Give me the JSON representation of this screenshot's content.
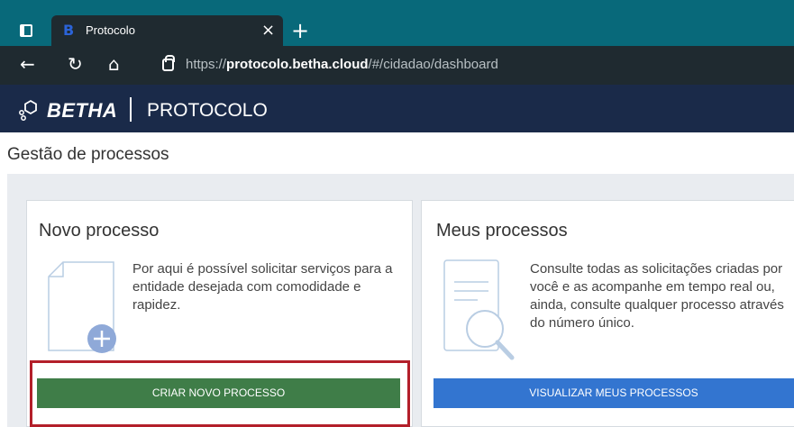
{
  "browser": {
    "tab_title": "Protocolo",
    "tab_favicon": "B",
    "tab_close": "×",
    "new_tab": "+",
    "back": "←",
    "reload": "↻",
    "home": "⌂",
    "url_scheme": "https://",
    "url_host": "protocolo.betha.cloud",
    "url_path": "/#/cidadao/dashboard"
  },
  "header": {
    "brand": "BETHA",
    "product": "PROTOCOLO"
  },
  "page": {
    "title": "Gestão de processos"
  },
  "cards": [
    {
      "title": "Novo processo",
      "text": "Por aqui é possível solicitar serviços para a entidade desejada com comodidade e rapidez.",
      "button": "CRIAR NOVO PROCESSO",
      "button_color": "#3f7d48"
    },
    {
      "title": "Meus processos",
      "text": "Consulte todas as solicitações criadas por você e as acompanhe em tempo real ou, ainda, consulte qualquer processo através do número único.",
      "button": "VISUALIZAR MEUS PROCESSOS",
      "button_color": "#3375d0"
    }
  ],
  "colors": {
    "tab_strip": "#08697a",
    "app_header": "#1a2a49",
    "highlight": "#b31f2a"
  }
}
